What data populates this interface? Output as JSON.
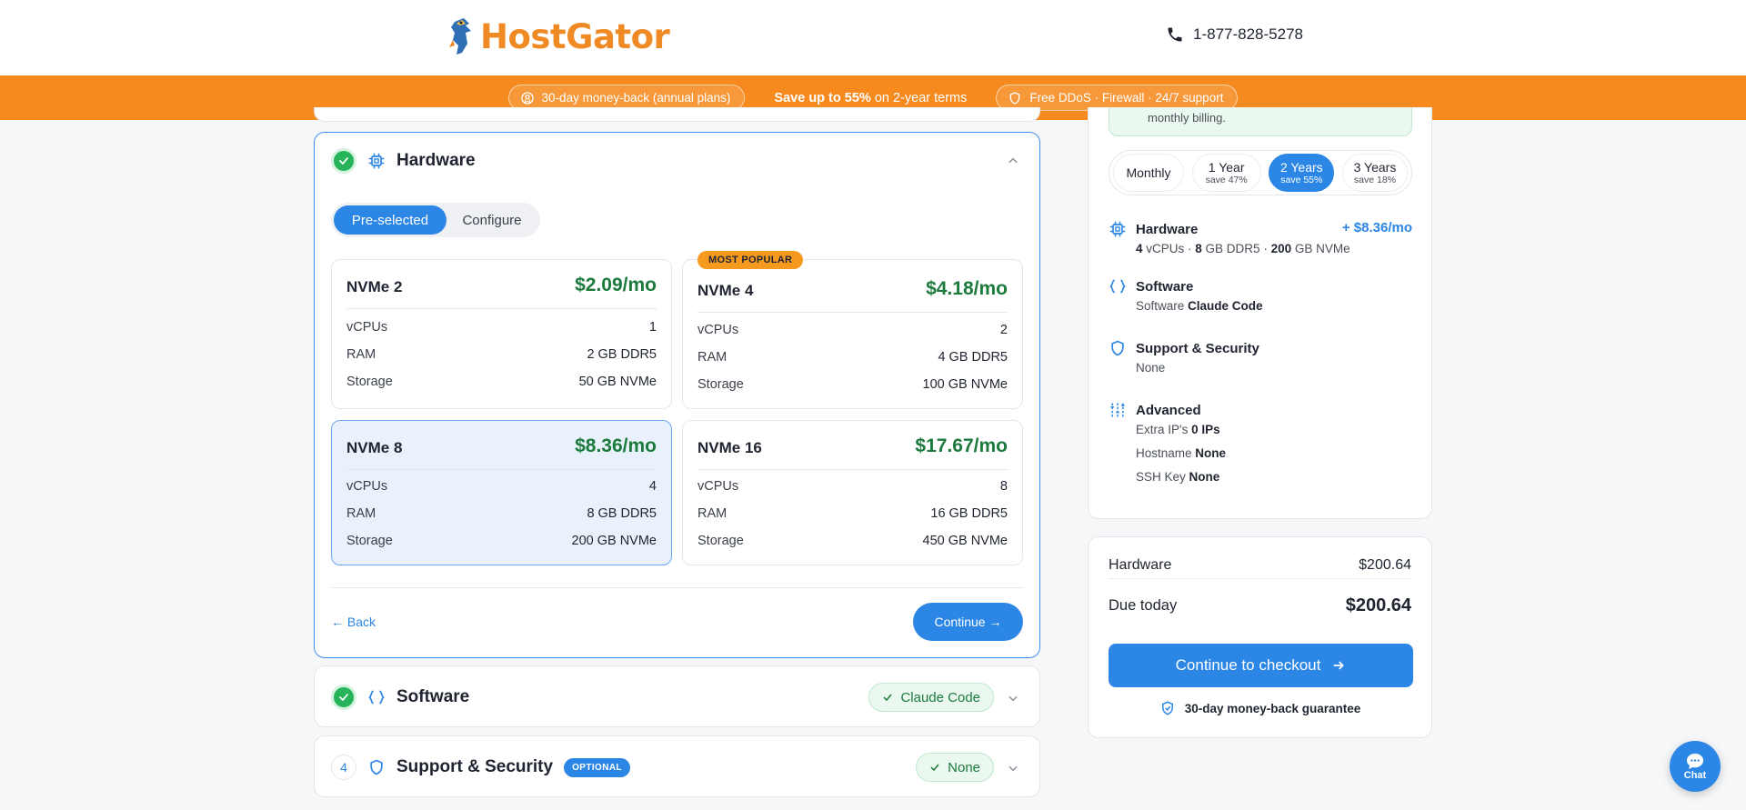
{
  "header": {
    "logo_text": "HostGator",
    "phone": "1-877-828-5278"
  },
  "promo": {
    "left_pill": "30-day money-back (annual plans)",
    "middle_bold": "Save up to 55%",
    "middle_rest": " on 2-year terms",
    "right_pill": "Free DDoS · Firewall · 24/7 support"
  },
  "hardware": {
    "title": "Hardware",
    "toggle": [
      "Pre-selected",
      "Configure"
    ],
    "plans": [
      {
        "name": "NVMe 2",
        "price": "$2.09/mo",
        "vcpus": "1",
        "ram": "2 GB DDR5",
        "storage": "50 GB NVMe",
        "badge": ""
      },
      {
        "name": "NVMe 4",
        "price": "$4.18/mo",
        "vcpus": "2",
        "ram": "4 GB DDR5",
        "storage": "100 GB NVMe",
        "badge": "MOST POPULAR"
      },
      {
        "name": "NVMe 8",
        "price": "$8.36/mo",
        "vcpus": "4",
        "ram": "8 GB DDR5",
        "storage": "200 GB NVMe",
        "badge": ""
      },
      {
        "name": "NVMe 16",
        "price": "$17.67/mo",
        "vcpus": "8",
        "ram": "16 GB DDR5",
        "storage": "450 GB NVMe",
        "badge": ""
      }
    ],
    "row_labels": {
      "vcpus": "vCPUs",
      "ram": "RAM",
      "storage": "Storage"
    },
    "back": "← Back",
    "continue": "Continue →"
  },
  "software": {
    "title": "Software",
    "value": "Claude Code"
  },
  "support": {
    "step": "4",
    "title": "Support & Security",
    "badge": "OPTIONAL",
    "value": "None"
  },
  "summary": {
    "note": "monthly billing.",
    "billing": [
      {
        "term": "Monthly",
        "save": ""
      },
      {
        "term": "1 Year",
        "save": "save 47%"
      },
      {
        "term": "2 Years",
        "save": "save 55%"
      },
      {
        "term": "3 Years",
        "save": "save 18%"
      }
    ],
    "hardware_title": "Hardware",
    "hardware_price": "+ $8.36/mo",
    "hw_vcpu_n": "4",
    "hw_vcpu": " vCPUs",
    "hw_ram_n": "8",
    "hw_ram": " GB DDR5",
    "hw_sto_n": "200",
    "hw_sto": " GB NVMe",
    "software_title": "Software",
    "software_label": "Software ",
    "software_value": "Claude Code",
    "support_title": "Support & Security",
    "support_value": "None",
    "advanced_title": "Advanced",
    "adv": [
      {
        "label": "Extra IP's ",
        "value": "0 IPs"
      },
      {
        "label": "Hostname ",
        "value": "None"
      },
      {
        "label": "SSH Key ",
        "value": "None"
      }
    ]
  },
  "totals": {
    "hardware_label": "Hardware",
    "hardware_value": "$200.64",
    "due_label": "Due today",
    "due_value": "$200.64",
    "checkout": "Continue to checkout",
    "guarantee": "30-day money-back guarantee"
  },
  "chat": {
    "label": "Chat"
  },
  "colors": {
    "brand_orange": "#f68a1f",
    "accent_blue": "#2b86e5",
    "price_green": "#1c7a3c"
  }
}
